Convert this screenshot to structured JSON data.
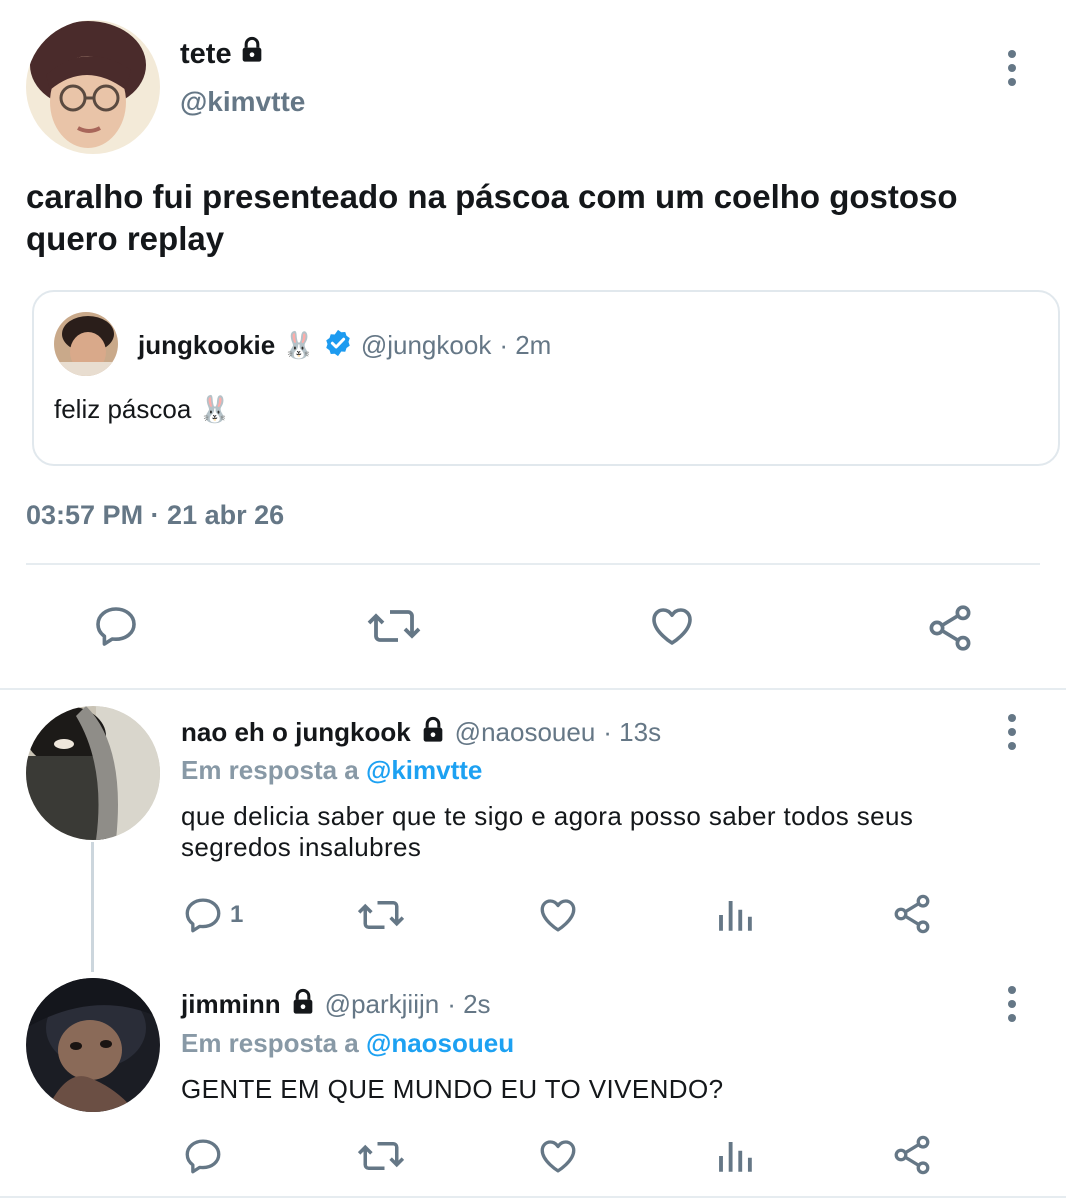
{
  "tweet": {
    "author_name": "tete",
    "author_handle": "@kimvtte",
    "text": "caralho fui presenteado na páscoa com um coelho gostoso quero replay",
    "timestamp": "03:57 PM · 21 abr 26",
    "locked": true,
    "icons": {
      "lock": "lock-icon",
      "more": "more-options-icon"
    }
  },
  "quote": {
    "author_name": "jungkookie 🐰",
    "verified": true,
    "author_handle": "@jungkook",
    "time": "· 2m",
    "text": "feliz páscoa 🐰"
  },
  "actions": {
    "reply": "reply-icon",
    "retweet": "retweet-icon",
    "like": "like-icon",
    "share": "share-icon"
  },
  "replies": [
    {
      "author_name": "nao eh o jungkook",
      "author_handle": "@naosoueu",
      "time": "· 13s",
      "reply_prefix": "Em resposta a",
      "reply_to": "@kimvtte",
      "text_line1": "que delicia saber que te sigo e agora posso saber todos seus",
      "text_line2": "segredos insalubres",
      "reply_count": "1"
    },
    {
      "author_name": "jimminn",
      "author_handle": "@parkjiijn",
      "time": "· 2s",
      "reply_prefix": "Em resposta a",
      "reply_to": "@naosoueu",
      "text_line1": "GENTE EM QUE MUNDO EU TO VIVENDO?",
      "reply_count": ""
    }
  ],
  "colors": {
    "accent": "#1da1f2",
    "secondary_text": "#657786",
    "primary_text": "#14171a",
    "border": "#e1e8ed"
  }
}
